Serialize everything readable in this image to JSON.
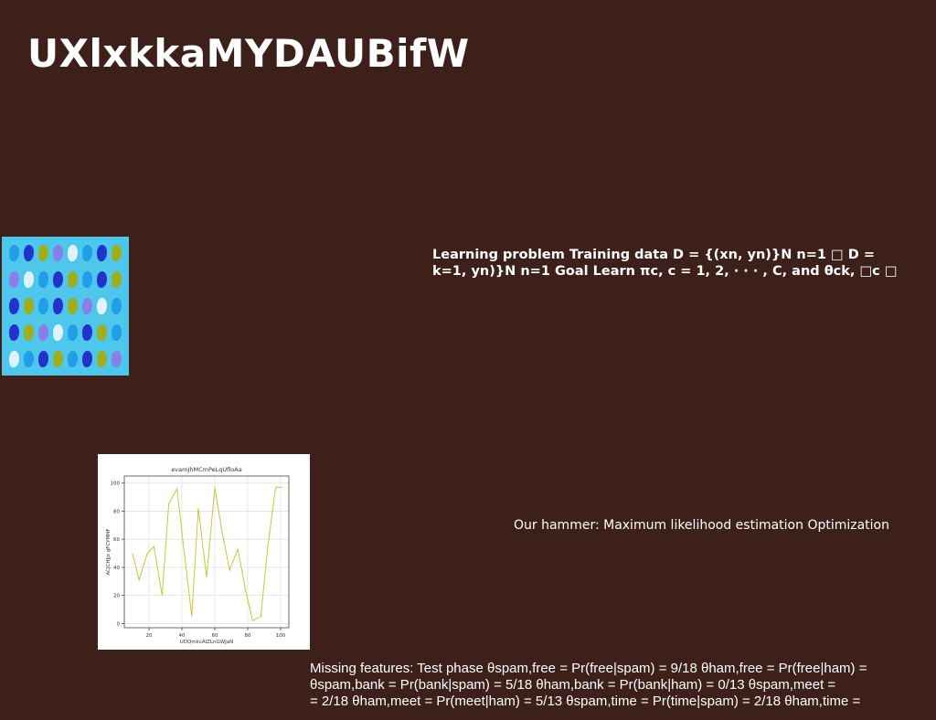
{
  "slide": {
    "title": "UXlxkkaMYDAUBifW",
    "background_color": "#3c2019",
    "learning_text": "Learning problem Training data D = {(xn, yn)}N n=1 □ D = \nk=1, yn)}N n=1 Goal Learn πc, c = 1, 2, · · · , C, and θck, □c □",
    "hammer_text": "Our hammer: Maximum likelihood estimation Optimization",
    "missing_text": "Missing features: Test phase θspam,free = Pr(free|spam) = 9/18 θham,free = Pr(free|ham) = \nθspam,bank = Pr(bank|spam) = 5/18 θham,bank = Pr(bank|ham) = 0/13 θspam,meet = \n= 2/18 θham,meet = Pr(meet|ham) = 5/13 θspam,time = Pr(time|spam) = 2/18 θham,time ="
  },
  "icon_grid": {
    "background": "#4fc6ec",
    "rows": 5,
    "columns": 8,
    "colors": [
      "#1e9fe6",
      "#2233c9",
      "#9fae1a",
      "#8a7fe8",
      "#dff3fb",
      "#1e9fe6",
      "#2233c9",
      "#9fae1a"
    ]
  },
  "chart_data": {
    "type": "line",
    "title": "evamJhMCmPeLqUfloAa",
    "xlabel": "UDQmkcAlZLnGWJaN",
    "ylabel": "ACJCHJjx gFCYMHF",
    "xlim": [
      5,
      105
    ],
    "ylim": [
      -3,
      105
    ],
    "x_ticks": [
      20,
      40,
      60,
      80,
      100
    ],
    "y_ticks": [
      0,
      20,
      40,
      60,
      80,
      100
    ],
    "grid": true,
    "line_color": "#c9c53a",
    "series": [
      {
        "x": [
          10,
          14,
          19,
          23,
          28,
          32,
          37,
          41,
          46,
          50,
          55,
          60,
          64,
          69,
          74,
          79,
          83,
          88,
          92,
          97,
          101
        ],
        "values": [
          50,
          31,
          50,
          55,
          20,
          85,
          96,
          55,
          5,
          82,
          33,
          97,
          68,
          38,
          53,
          22,
          2,
          5,
          53,
          97,
          97
        ]
      }
    ]
  }
}
